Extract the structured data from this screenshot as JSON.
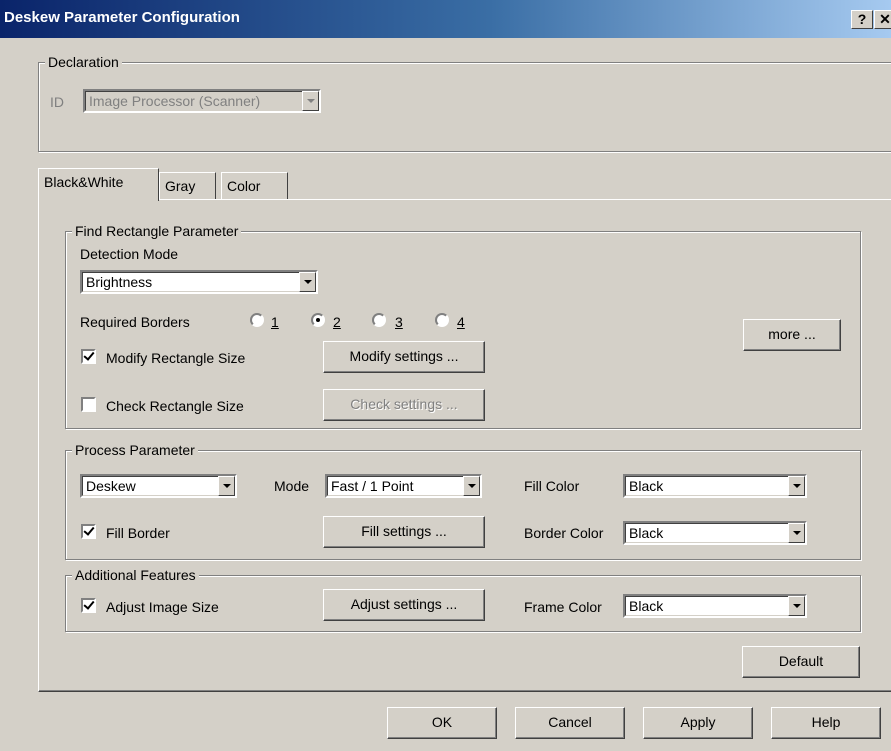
{
  "window": {
    "title": "Deskew Parameter Configuration",
    "help_glyph": "?",
    "close_glyph": "✕"
  },
  "declaration": {
    "legend": "Declaration",
    "id_label": "ID",
    "id_value": "Image Processor (Scanner)"
  },
  "tabs": [
    {
      "label": "Black&White",
      "active": true
    },
    {
      "label": "Gray",
      "active": false
    },
    {
      "label": "Color",
      "active": false
    }
  ],
  "find_rect": {
    "legend": "Find Rectangle Parameter",
    "detection_mode_label": "Detection Mode",
    "detection_mode_value": "Brightness",
    "required_borders_label": "Required Borders",
    "borders": [
      "1",
      "2",
      "3",
      "4"
    ],
    "borders_selected": "2",
    "modify_label": "Modify Rectangle Size",
    "modify_checked": true,
    "modify_button": "Modify settings ...",
    "check_label": "Check Rectangle Size",
    "check_checked": false,
    "check_button": "Check settings ...",
    "more_button": "more ..."
  },
  "process": {
    "legend": "Process Parameter",
    "process_value": "Deskew",
    "mode_label": "Mode",
    "mode_value": "Fast / 1 Point",
    "fill_color_label": "Fill Color",
    "fill_color_value": "Black",
    "fill_border_label": "Fill Border",
    "fill_border_checked": true,
    "fill_settings_button": "Fill settings ...",
    "border_color_label": "Border Color",
    "border_color_value": "Black"
  },
  "additional": {
    "legend": "Additional Features",
    "adjust_label": "Adjust Image Size",
    "adjust_checked": true,
    "adjust_button": "Adjust settings ...",
    "frame_color_label": "Frame Color",
    "frame_color_value": "Black"
  },
  "default_button": "Default",
  "footer": {
    "ok": "OK",
    "cancel": "Cancel",
    "apply": "Apply",
    "help": "Help"
  },
  "colors": {
    "title_start": "#0a246a",
    "title_end": "#a6caf0",
    "face": "#d4d0c8"
  }
}
